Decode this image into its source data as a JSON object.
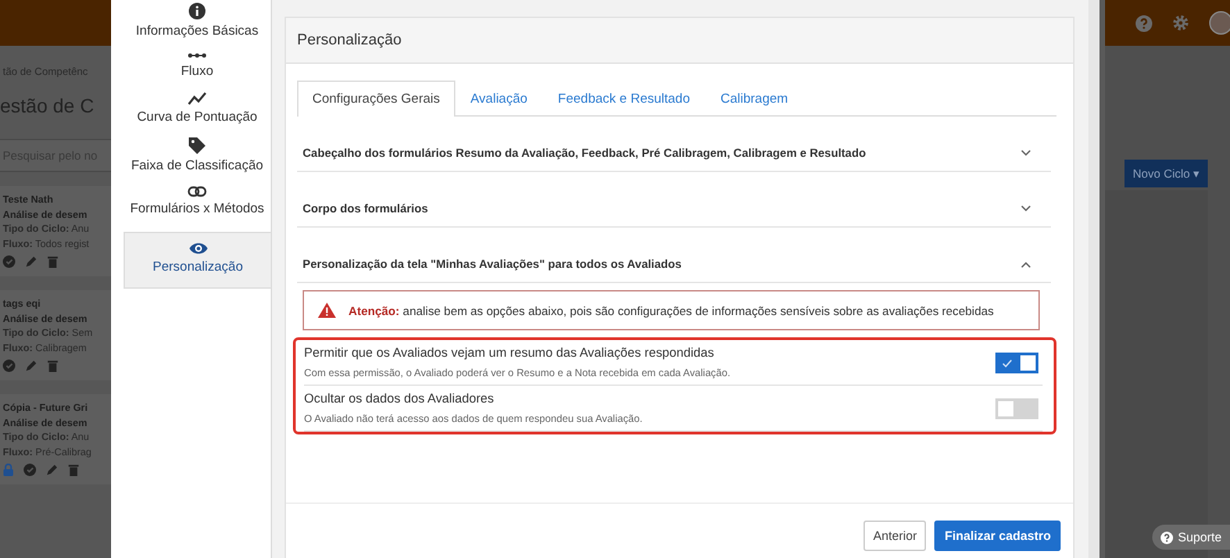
{
  "background": {
    "breadcrumb": "tão de Competênc",
    "page_title": "estão de C",
    "search": {
      "placeholder": "Pesquisar pelo no"
    },
    "cycles": [
      {
        "name": "Teste Nath",
        "type": "Análise de desem",
        "cycle_type": "**Tipo do Ciclo:** Anu",
        "flow": "**Fluxo:** Todos regist",
        "locked": false
      },
      {
        "name": "tags eqi",
        "type": "Análise de desem",
        "cycle_type": "**Tipo do Ciclo:** Sem",
        "flow": "**Fluxo:** Calibragem",
        "locked": false
      },
      {
        "name": "Cópia - Future Gri",
        "type": "Análise de desem",
        "cycle_type": "**Tipo do Ciclo:** Anu",
        "flow": "**Fluxo:** Pré-Calibrag",
        "locked": true
      }
    ],
    "new_cycle_button": "Novo Ciclo",
    "new_cycle_caret": "▾"
  },
  "modal": {
    "nav": [
      {
        "label": "Informações Básicas",
        "selected": false
      },
      {
        "label": "Fluxo",
        "selected": false
      },
      {
        "label": "Curva de Pontuação",
        "selected": false
      },
      {
        "label": "Faixa de Classificação",
        "selected": false
      },
      {
        "label": "Formulários x Métodos",
        "selected": false
      },
      {
        "label": "Personalização",
        "selected": true
      }
    ],
    "panel": {
      "title": "Personalização",
      "tabs": [
        {
          "label": "Configurações Gerais",
          "selected": true
        },
        {
          "label": "Avaliação",
          "selected": false
        },
        {
          "label": "Feedback e Resultado",
          "selected": false
        },
        {
          "label": "Calibragem",
          "selected": false
        }
      ],
      "sections": [
        {
          "title": "Cabeçalho dos formulários Resumo da Avaliação, Feedback, Pré Calibragem, Calibragem e Resultado",
          "expanded": false
        },
        {
          "title": "Corpo dos formulários",
          "expanded": false
        },
        {
          "title": "Personalização da tela \"Minhas Avaliações\" para todos os Avaliados",
          "expanded": true
        }
      ],
      "alert": "**Atenção:** analise bem as opções abaixo, pois são configurações de informações sensíveis sobre as avaliações recebidas",
      "options": [
        {
          "title": "Permitir que os Avaliados vejam um resumo das Avaliações respondidas",
          "description": "Com essa permissão, o Avaliado poderá ver o Resumo e a Nota recebida em cada Avaliação.",
          "on": true
        },
        {
          "title": "Ocultar os dados dos Avaliadores",
          "description": "O Avaliado não terá acesso aos dados de quem respondeu sua Avaliação.",
          "on": false
        }
      ],
      "buttons": [
        {
          "label": "Anterior",
          "kind": "secondary"
        },
        {
          "label": "Finalizar cadastro",
          "kind": "primary"
        }
      ]
    }
  },
  "support_button": "Suporte"
}
